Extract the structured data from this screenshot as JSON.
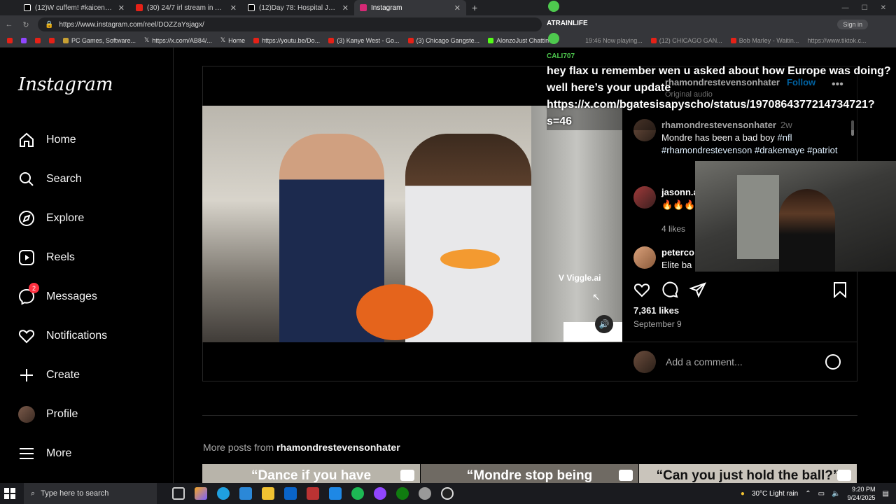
{
  "browser": {
    "tabs": [
      {
        "title": "(12)W cuffem! #kaicenat #cuffem",
        "color": "#ffffff",
        "active": false
      },
      {
        "title": "(30) 24/7 irl stream in America us",
        "color": "#e62117",
        "active": false
      },
      {
        "title": "(12)Day 78: Hospital Journey & H",
        "color": "#ffffff",
        "active": false
      },
      {
        "title": "Instagram",
        "color": "#d62976",
        "active": true
      }
    ],
    "url": "https://www.instagram.com/reel/DOZZaYsjagx/",
    "sign_in": "Sign in",
    "bookmarks": [
      "PC Games, Software...",
      "https://x.com/AB84/...",
      "Home",
      "https://youtu.be/Do...",
      "(3) Kanye West - Go...",
      "(3) Chicago Gangste...",
      "AlonzoJust Chattin",
      "19:46 Now playing...",
      "(12) CHICAGO GAN...",
      "Bob Marley - Waitin...",
      "https://www.tiktok.c..."
    ]
  },
  "sidebar": {
    "logo": "Instagram",
    "items": [
      {
        "label": "Home",
        "icon": "home-icon"
      },
      {
        "label": "Search",
        "icon": "search-icon"
      },
      {
        "label": "Explore",
        "icon": "compass-icon"
      },
      {
        "label": "Reels",
        "icon": "reels-icon"
      },
      {
        "label": "Messages",
        "icon": "messenger-icon",
        "badge": "2"
      },
      {
        "label": "Notifications",
        "icon": "heart-icon"
      },
      {
        "label": "Create",
        "icon": "plus-icon"
      },
      {
        "label": "Profile",
        "icon": "avatar-icon"
      },
      {
        "label": "More",
        "icon": "menu-icon"
      }
    ]
  },
  "post": {
    "username": "rhamondrestevensonhater",
    "follow": "Follow",
    "audio": "Original audio",
    "watermark": "Viggle.ai",
    "caption": {
      "user": "rhamondrestevensonhater",
      "time": "2w",
      "text": "Mondre has been a bad boy",
      "tags": "#nfl #rhamondrestevenson #drakemaye #patriot"
    },
    "comments": [
      {
        "user": "jasonn.a",
        "text": "🔥🔥🔥",
        "likes": "4 likes"
      },
      {
        "user": "peterco",
        "text": "Elite ba"
      }
    ],
    "likes": "7,361 likes",
    "date": "September 9",
    "comment_placeholder": "Add a comment..."
  },
  "more_posts": {
    "label": "More posts from",
    "user": "rhamondrestevensonhater",
    "thumbs": [
      "“Dance if you have",
      "“Mondre stop being",
      "“Can you just hold the ball?”"
    ]
  },
  "stream_chat": {
    "user1": "ATRAINLIFE",
    "user2": "CALI707",
    "message": "hey flax u remember wen u asked about how Europe was doing? well here’s your update https://x.com/bgatesisapyscho/status/1970864377214734721?s=46"
  },
  "taskbar": {
    "search_placeholder": "Type here to search",
    "weather": "30°C  Light rain",
    "time": "9:20 PM",
    "date": "9/24/2025"
  }
}
